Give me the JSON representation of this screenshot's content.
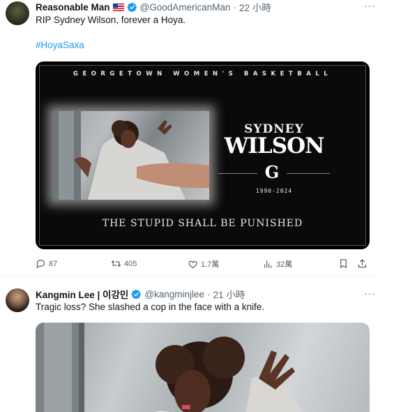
{
  "tweets": [
    {
      "display_name": "Reasonable Man",
      "handle": "@GoodAmericanMan",
      "time": "22 小時",
      "more": "···",
      "text": "RIP Sydney Wilson, forever a Hoya.",
      "hashtag": "#HoyaSaxa",
      "media": {
        "banner": "GEORGETOWN WOMEN'S BASKETBALL",
        "name_first": "SYDNEY",
        "name_last": "WILSON",
        "logo_letter": "G",
        "years": "1990-2024",
        "motto": "THE STUPID SHALL BE PUNISHED"
      },
      "actions": {
        "replies": "87",
        "retweets": "405",
        "likes": "1.7萬",
        "views": "32萬"
      }
    },
    {
      "display_name": "Kangmin Lee | 이강민",
      "handle": "@kangminjlee",
      "time": "21 小時",
      "more": "···",
      "text": "Tragic loss? She slashed a cop in the face with a knife."
    }
  ],
  "colors": {
    "accent": "#1d9bf0",
    "secondary_text": "#536471",
    "primary_text": "#0f1419"
  },
  "icons": [
    "reply-icon",
    "retweet-icon",
    "like-icon",
    "views-icon",
    "bookmark-icon",
    "share-icon",
    "verified-badge-icon",
    "us-flag-icon",
    "more-icon"
  ]
}
